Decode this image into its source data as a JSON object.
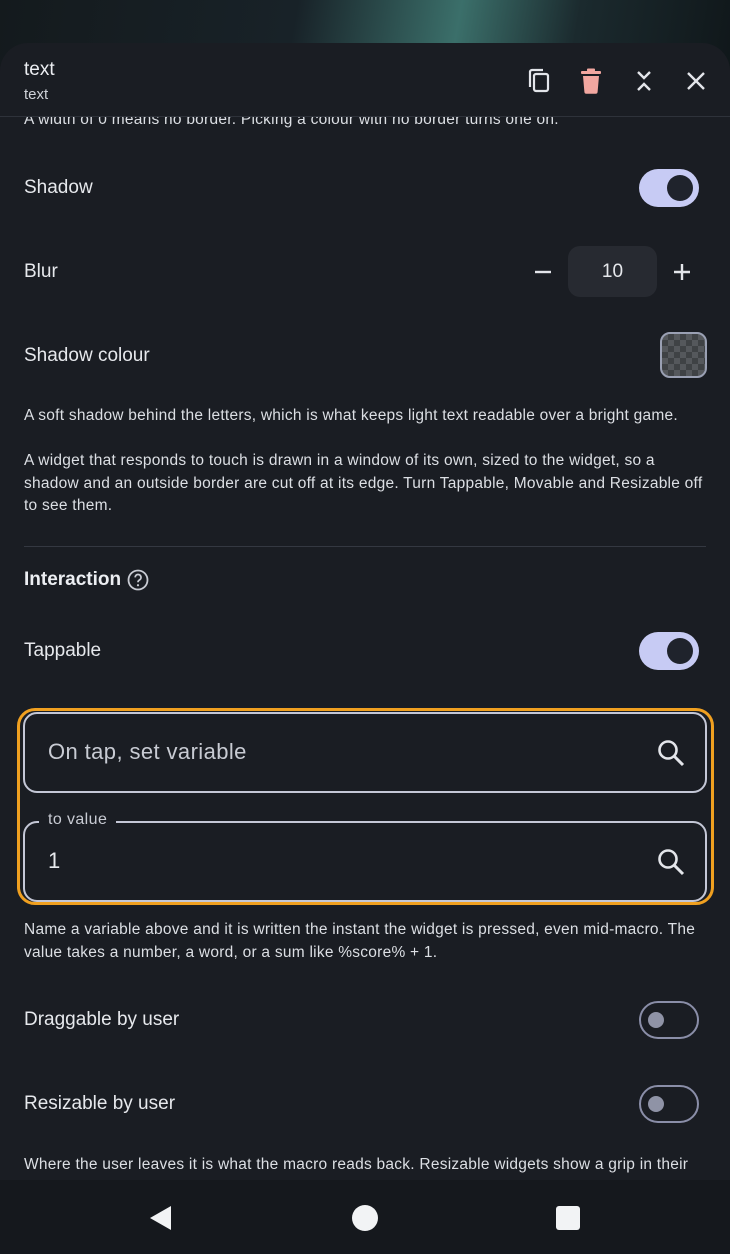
{
  "header": {
    "title": "text",
    "subtitle": "text",
    "icons": [
      "copy-icon",
      "delete-icon",
      "collapse-icon",
      "close-icon"
    ]
  },
  "border_note_partial": "A width of 0 means no border. Picking a colour with no border turns one on.",
  "shadow": {
    "label": "Shadow",
    "enabled": true
  },
  "blur": {
    "label": "Blur",
    "value": "10",
    "decrement_icon": "minus-icon",
    "increment_icon": "plus-icon"
  },
  "shadow_colour": {
    "label": "Shadow colour"
  },
  "shadow_desc_1": "A soft shadow behind the letters, which is what keeps light text readable over a bright game.",
  "shadow_desc_2": "A widget that responds to touch is drawn in a window of its own, sized to the widget, so a shadow and an outside border are cut off at its edge. Turn Tappable, Movable and Resizable off to see them.",
  "interaction": {
    "title": "Interaction",
    "help_icon": "help-icon"
  },
  "tappable": {
    "label": "Tappable",
    "enabled": true
  },
  "on_tap_field": {
    "placeholder": "On tap, set variable",
    "icon": "search-icon"
  },
  "to_value_field": {
    "legend": "to value",
    "value": "1",
    "icon": "search-icon"
  },
  "variable_desc": "Name a variable above and it is written the instant the widget is pressed, even mid-macro. The value takes a number, a word, or a sum like %score% + 1.",
  "draggable": {
    "label": "Draggable by user",
    "enabled": false
  },
  "resizable": {
    "label": "Resizable by user",
    "enabled": false
  },
  "resizable_desc_partial": "Where the user leaves it is what the macro reads back. Resizable widgets show a grip in their",
  "colors": {
    "accent_toggle": "#c7cbf4",
    "highlight_border": "#f0a020",
    "delete_icon": "#f2a7a0",
    "sheet_background": "#1a1d23"
  },
  "navbar": {
    "icons": [
      "back-icon",
      "home-icon",
      "recents-icon"
    ]
  }
}
